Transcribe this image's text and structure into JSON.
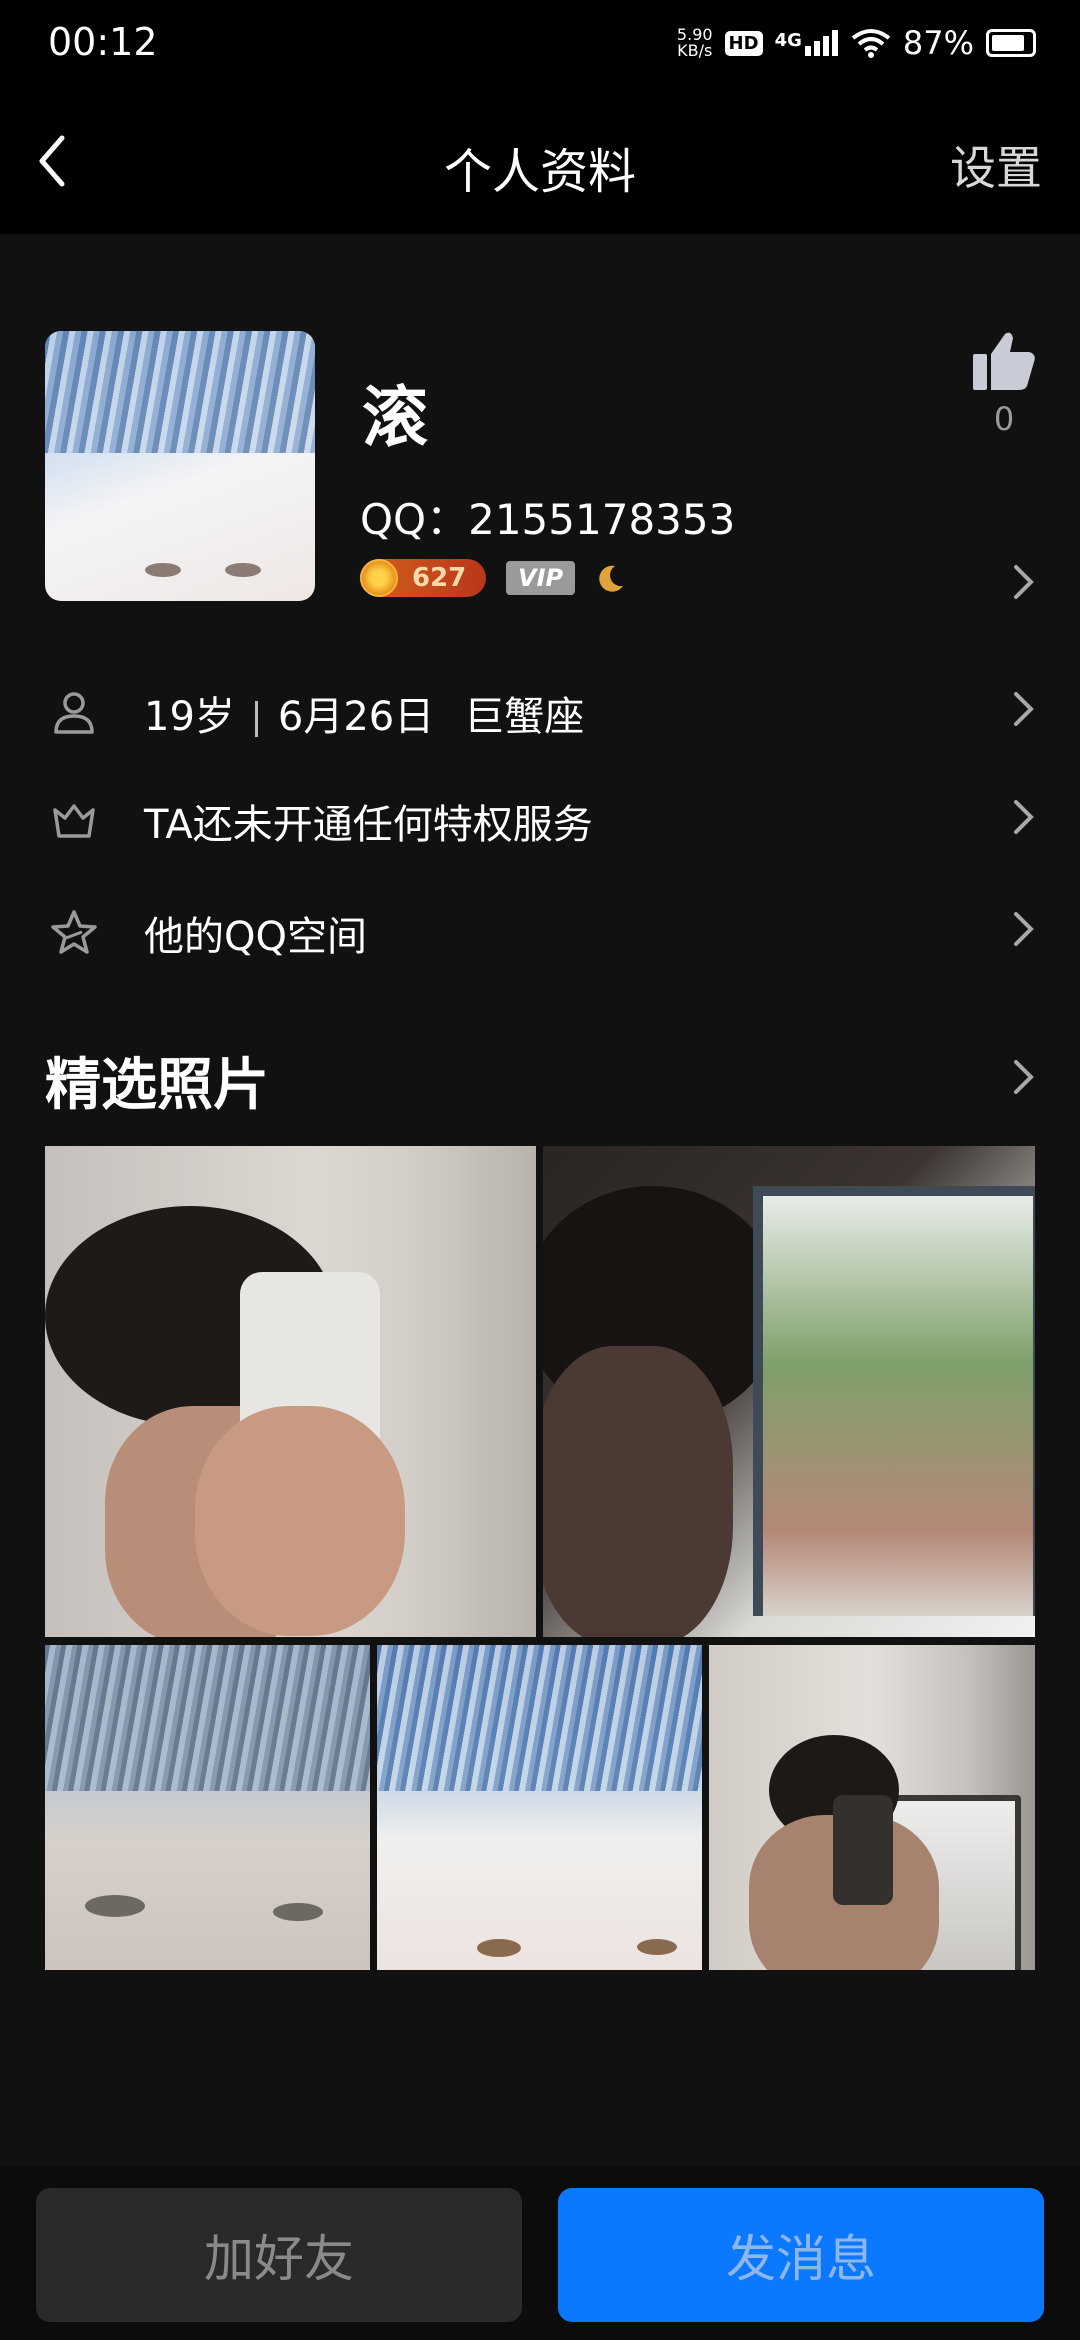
{
  "status_bar": {
    "time": "00:12",
    "net_speed": "5.90",
    "net_unit": "KB/s",
    "hd": "HD",
    "network": "4G",
    "battery": "87%"
  },
  "nav": {
    "title": "个人资料",
    "settings": "设置"
  },
  "profile": {
    "name": "滚",
    "qq": "QQ：2155178353",
    "level": "627",
    "vip": "VIP",
    "likes": "0"
  },
  "info": {
    "age": "19岁",
    "birthday": "6月26日",
    "zodiac": "巨蟹座",
    "privilege": "TA还未开通任何特权服务",
    "qzone": "他的QQ空间"
  },
  "photos_section": {
    "title": "精选照片"
  },
  "actions": {
    "add_friend": "加好友",
    "send_message": "发消息"
  },
  "colors": {
    "accent": "#0a78ff",
    "background": "#111111"
  }
}
